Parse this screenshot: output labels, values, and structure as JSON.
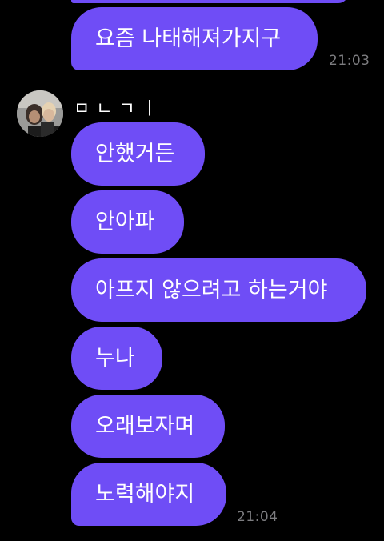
{
  "chat": {
    "sender_name": "ㅁㄴㄱㅣ",
    "avatar_icon": "profile-photo",
    "bubble_color": "#6F4DF6",
    "messages_top": [
      {
        "text": ""
      },
      {
        "text": "요즘 나태해져가지구"
      }
    ],
    "time_1": "21:03",
    "messages": [
      {
        "text": "안했거든"
      },
      {
        "text": "안아파"
      },
      {
        "text": "아프지 않으려고 하는거야"
      },
      {
        "text": "누나"
      },
      {
        "text": "오래보자며"
      },
      {
        "text": "노력해야지"
      }
    ],
    "time_2": "21:04"
  }
}
